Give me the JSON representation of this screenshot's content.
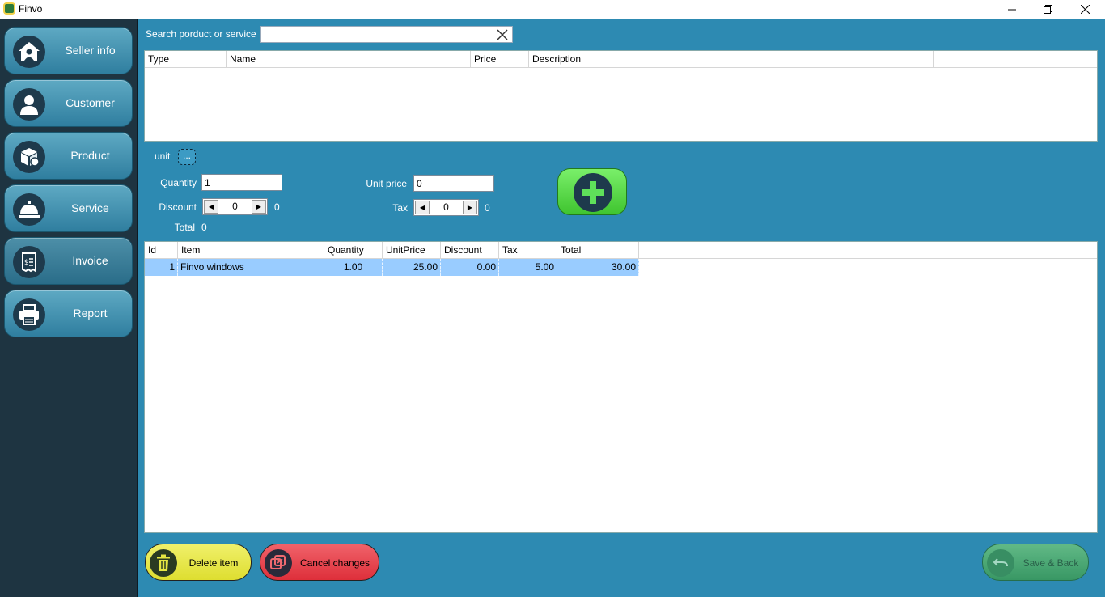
{
  "window": {
    "title": "Finvo"
  },
  "sidebar": {
    "items": [
      {
        "label": "Seller info",
        "icon": "house-person-icon"
      },
      {
        "label": "Customer",
        "icon": "person-icon"
      },
      {
        "label": "Product",
        "icon": "box-icon"
      },
      {
        "label": "Service",
        "icon": "bell-icon"
      },
      {
        "label": "Invoice",
        "icon": "receipt-icon",
        "active": true
      },
      {
        "label": "Report",
        "icon": "printer-icon"
      }
    ]
  },
  "search": {
    "label": "Search porduct or service",
    "value": ""
  },
  "products_table": {
    "columns": [
      "Type",
      "Name",
      "Price",
      "Description"
    ],
    "rows": []
  },
  "form": {
    "unit_label": "unit",
    "unit_button": "...",
    "quantity_label": "Quantity",
    "quantity_value": "1",
    "discount_label": "Discount",
    "discount_value": "0",
    "discount_result": "0",
    "total_label": "Total",
    "total_value": "0",
    "unit_price_label": "Unit price",
    "unit_price_value": "0",
    "tax_label": "Tax",
    "tax_value": "0",
    "tax_result": "0"
  },
  "items_table": {
    "columns": [
      "Id",
      "Item",
      "Quantity",
      "UnitPrice",
      "Discount",
      "Tax",
      "Total"
    ],
    "rows": [
      [
        "1",
        "Finvo windows",
        "1.00",
        "25.00",
        "0.00",
        "5.00",
        "30.00"
      ]
    ]
  },
  "actions": {
    "delete": "Delete item",
    "cancel": "Cancel changes",
    "save": "Save & Back"
  },
  "colors": {
    "sidebar_bg": "#1e3441",
    "main_bg": "#2d8ab2",
    "selected_row": "#99ccff",
    "add_green": "#3fc42f",
    "delete_yellow": "#e6e642",
    "cancel_red": "#e8434d",
    "save_green": "#3fa35f"
  }
}
